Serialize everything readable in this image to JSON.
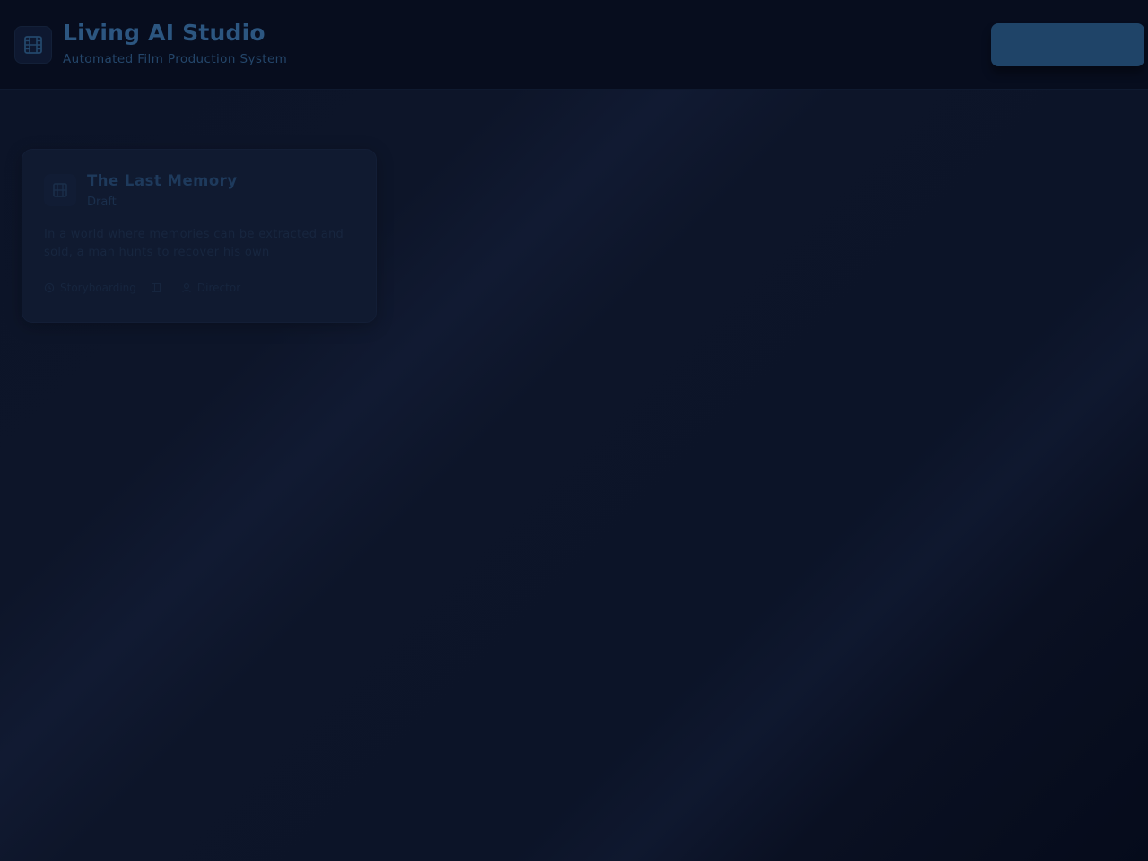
{
  "header": {
    "title": "Living AI Studio",
    "subtitle": "Automated Film Production System",
    "logo_icon": "film-icon",
    "new_button_label": ""
  },
  "projects": [
    {
      "title": "The Last Memory",
      "status": "Draft",
      "icon": "film-icon",
      "description": "In a world where memories can be extracted and sold, a man hunts to recover his own",
      "meta": [
        {
          "icon": "clock-icon",
          "label": "Storyboarding"
        },
        {
          "icon": "film-icon",
          "label": ""
        },
        {
          "icon": "user-icon",
          "label": "Director"
        }
      ]
    }
  ],
  "colors": {
    "background": "#0c1428",
    "header_bg": "#070d1e",
    "accent": "#2c5680",
    "button": "#1f4468"
  }
}
